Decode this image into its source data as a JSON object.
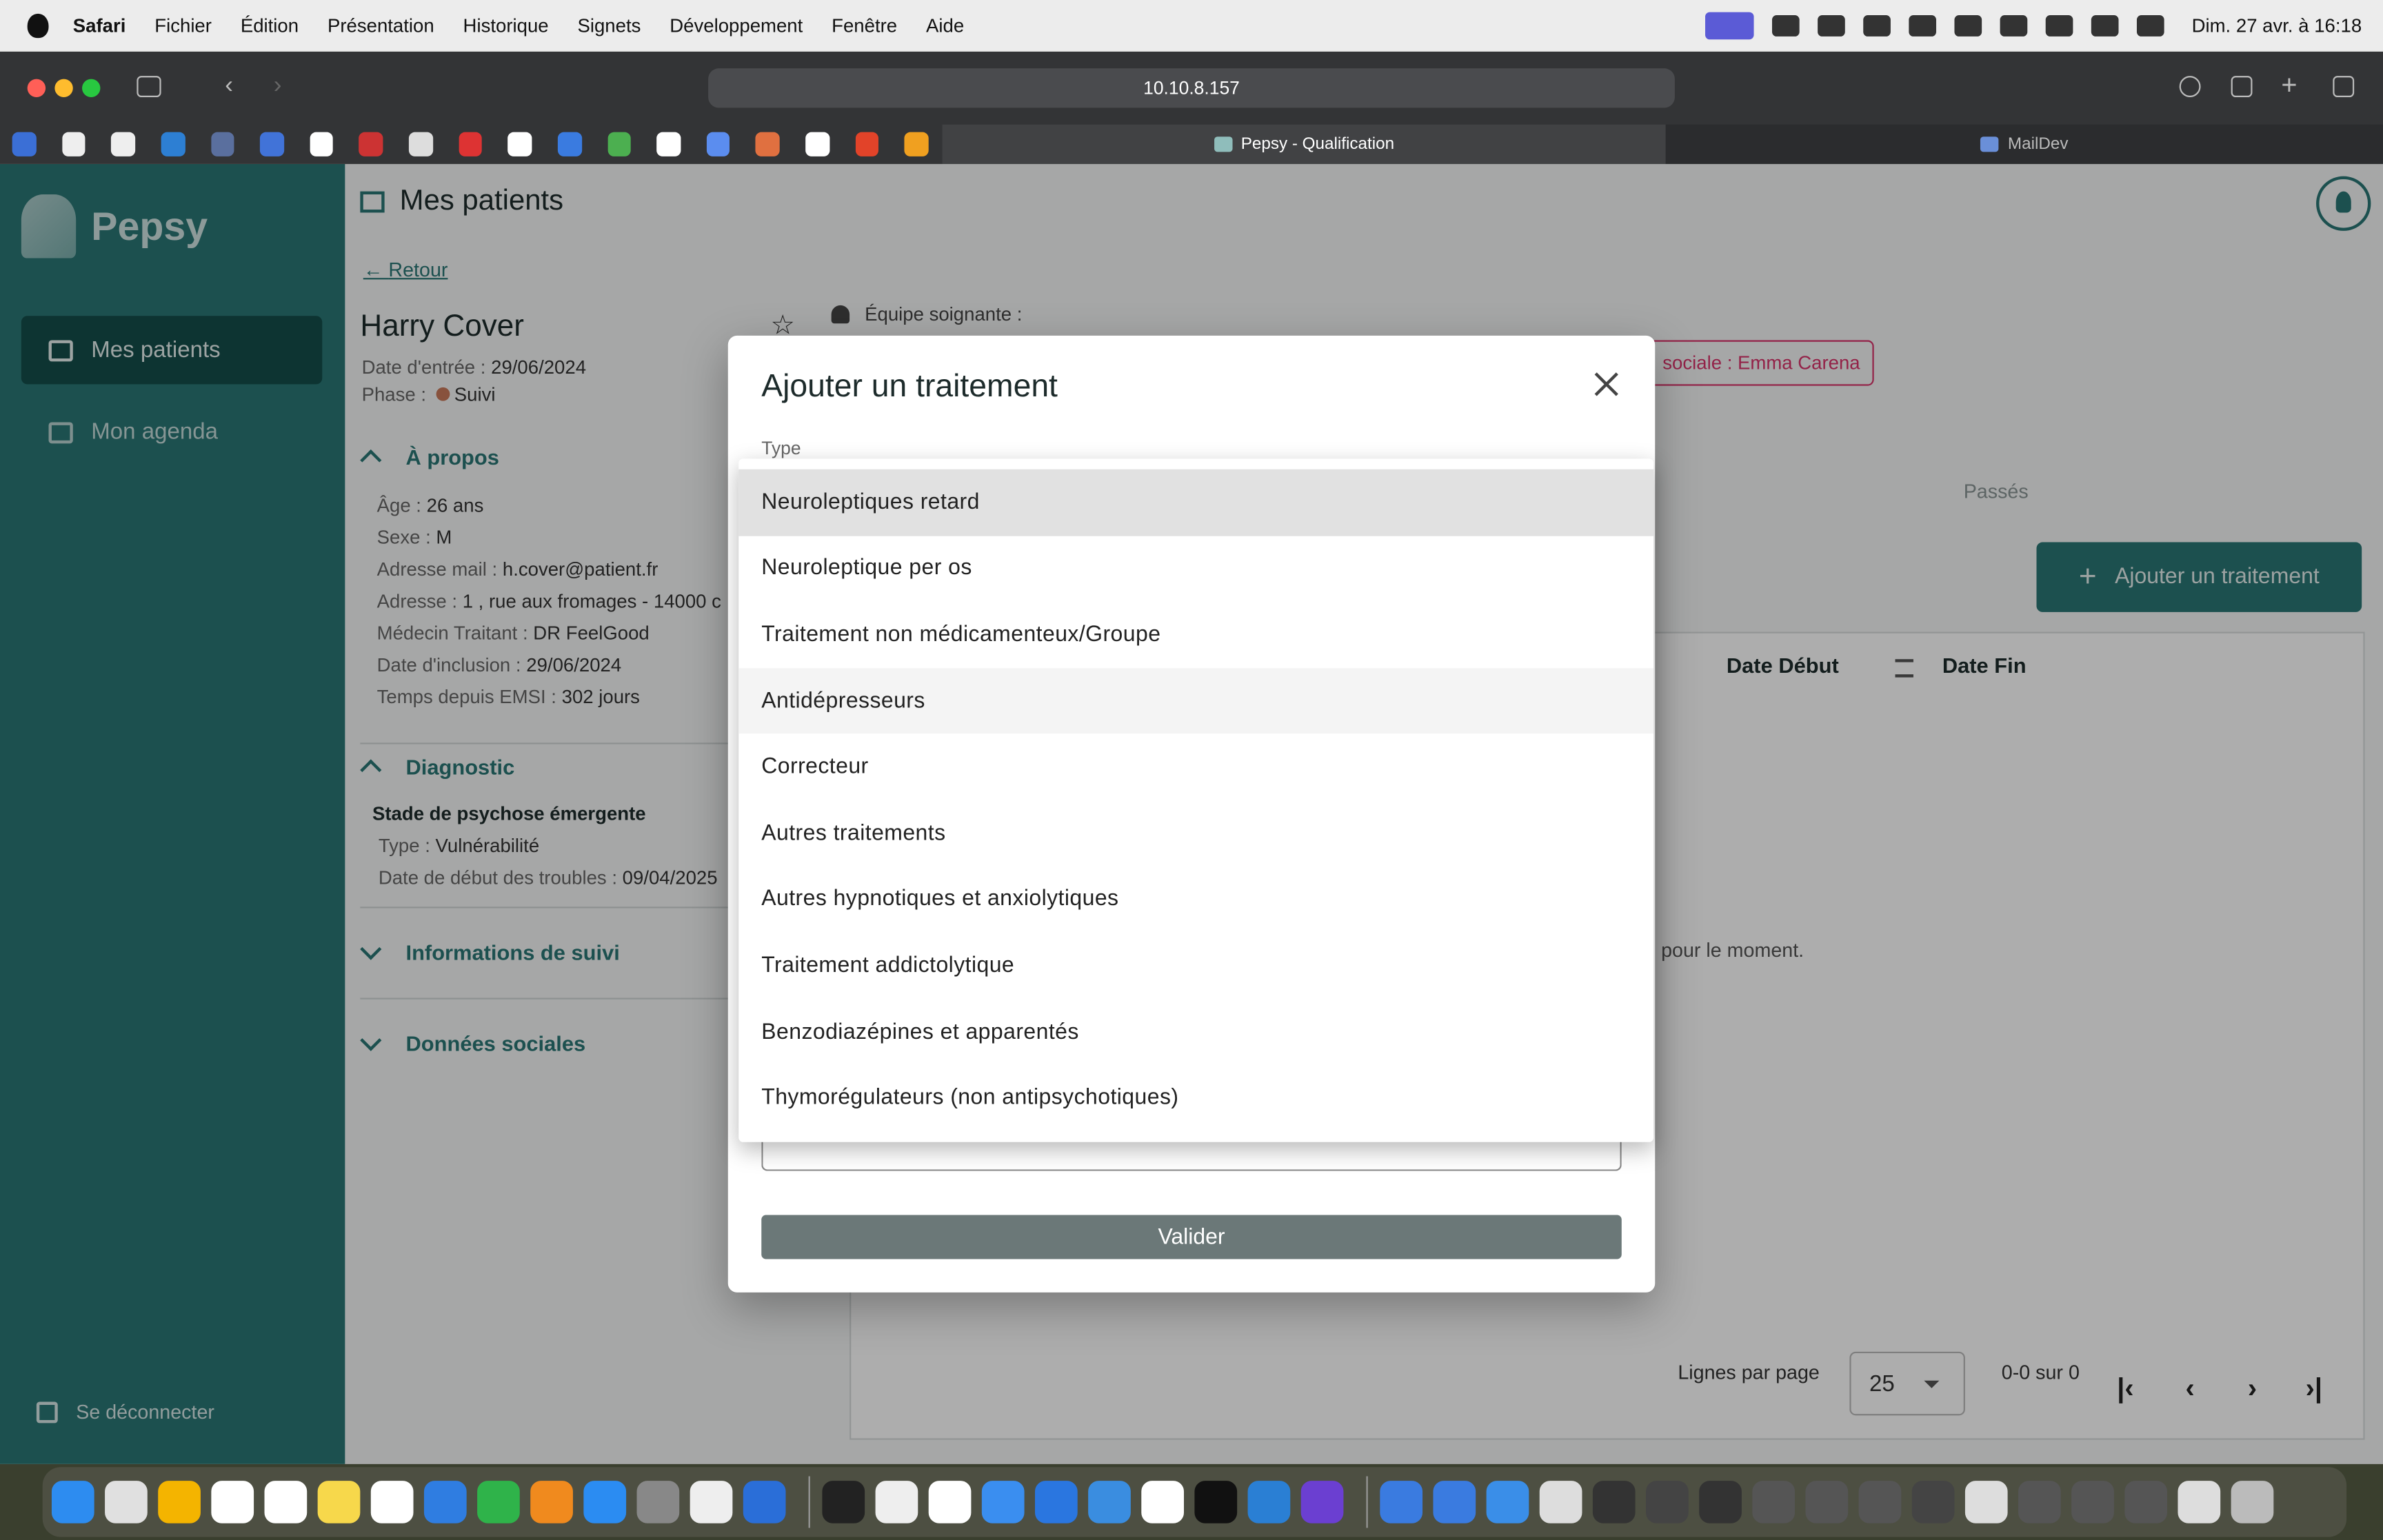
{
  "menubar": {
    "app": "Safari",
    "items": [
      "Fichier",
      "Édition",
      "Présentation",
      "Historique",
      "Signets",
      "Développement",
      "Fenêtre",
      "Aide"
    ],
    "clock": "Dim. 27 avr. à 16:18"
  },
  "browser": {
    "url": "10.10.8.157",
    "tabs": [
      {
        "label": "Pepsy - Qualification",
        "active": true
      },
      {
        "label": "MailDev",
        "active": false
      }
    ]
  },
  "sidebar": {
    "logo": "Pepsy",
    "items": [
      {
        "label": "Mes patients",
        "icon": "patients-list-icon",
        "active": true
      },
      {
        "label": "Mon agenda",
        "icon": "calendar-icon",
        "active": false
      }
    ],
    "logout": "Se déconnecter"
  },
  "page": {
    "title": "Mes patients",
    "back": "Retour",
    "patient": {
      "name": "Harry Cover",
      "entry_label": "Date d'entrée :",
      "entry_value": "29/06/2024",
      "phase_label": "Phase :",
      "phase_value": "Suivi"
    },
    "equipe_label": "Équipe soignante :",
    "tag": "sociale : Emma Carena",
    "apropos": {
      "title": "À propos",
      "rows": [
        {
          "label": "Âge :",
          "value": "26 ans"
        },
        {
          "label": "Sexe :",
          "value": "M"
        },
        {
          "label": "Adresse mail :",
          "value": "h.cover@patient.fr"
        },
        {
          "label": "Adresse :",
          "value": "1 , rue aux fromages - 14000 c"
        },
        {
          "label": "Médecin Traitant :",
          "value": "DR FeelGood"
        },
        {
          "label": "Date d'inclusion :",
          "value": "29/06/2024"
        },
        {
          "label": "Temps depuis EMSI :",
          "value": "302 jours"
        }
      ]
    },
    "diagnostic": {
      "title": "Diagnostic",
      "stade": "Stade de psychose émergente",
      "rows": [
        {
          "label": "Type :",
          "value": "Vulnérabilité"
        },
        {
          "label": "Date de début des troubles :",
          "value": "09/04/2025"
        }
      ]
    },
    "suivi_title": "Informations de suivi",
    "sociales_title": "Données sociales",
    "treatments": {
      "passes_tab": "Passés",
      "add_button": "Ajouter un traitement",
      "columns": [
        "Date Début",
        "Date Fin"
      ],
      "empty": "pour le moment.",
      "rows_per_page_label": "Lignes par page",
      "rows_per_page": "25",
      "range": "0-0 sur 0"
    }
  },
  "modal": {
    "title": "Ajouter un traitement",
    "type_label": "Type",
    "validate": "Valider",
    "options": [
      "Neuroleptiques retard",
      "Neuroleptique per os",
      "Traitement non médicamenteux/Groupe",
      "Antidépresseurs",
      "Correcteur",
      "Autres traitements",
      "Autres hypnotiques et anxiolytiques",
      "Traitement addictolytique",
      "Benzodiazépines et apparentés",
      "Thymorégulateurs (non antipsychotiques)"
    ],
    "selected_index": 0,
    "hover_index": 3
  },
  "colors": {
    "primary": "#2a7775",
    "sidebar_active": "#144d4b",
    "tag": "#d9336a",
    "phase_dot": "#c97a5a"
  }
}
